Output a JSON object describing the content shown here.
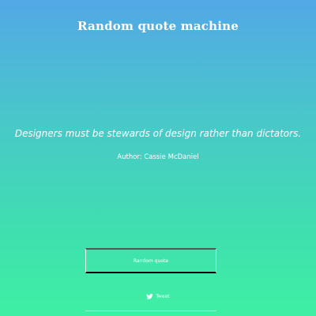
{
  "header": {
    "title": "Random quote machine"
  },
  "quote": {
    "text": "Designers must be stewards of design rather than dictators.",
    "author": "Author: Cassie McDaniel"
  },
  "actions": {
    "random_quote_label": "Random quote",
    "tweet_label": "Tweet",
    "tweet_icon": "twitter-icon"
  },
  "colors": {
    "gradient_top": "#53a8e6",
    "gradient_bottom": "#3ff0a4",
    "text": "#ffffff"
  }
}
